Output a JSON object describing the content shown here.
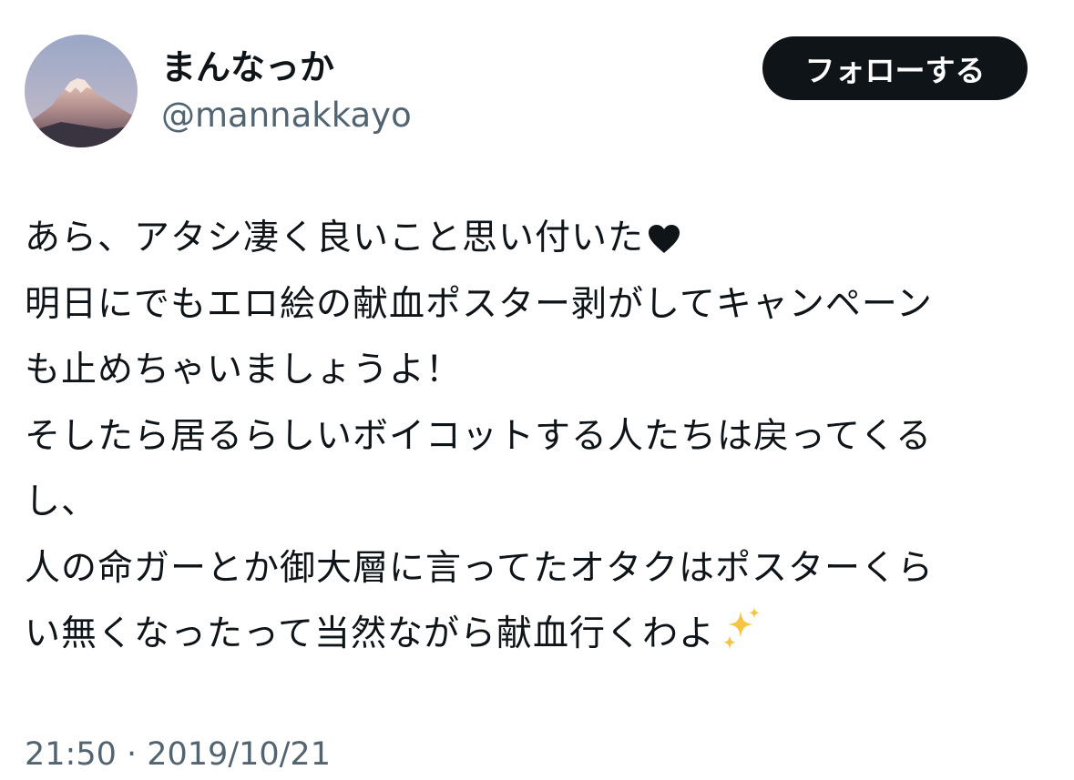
{
  "author": {
    "display_name": "まんなっか",
    "handle": "@mannakkayo",
    "avatar_icon": "mount-fuji-avatar"
  },
  "follow_button": {
    "label": "フォローする"
  },
  "tweet": {
    "lines": [
      "あら、アタシ凄く良いこと思い付いた",
      "明日にでもエロ絵の献血ポスター剥がしてキャンペーン",
      "も止めちゃいましょうよ！",
      "そしたら居るらしいボイコットする人たちは戻ってくる",
      "し、",
      "人の命ガーとか御大層に言ってたオタクはポスターくら",
      "い無くなったって当然ながら献血行くわよ"
    ],
    "emojis": {
      "line1_end": "black-heart-icon",
      "line7_end": "sparkles-icon"
    }
  },
  "meta": {
    "timestamp": "21:50 · 2019/10/21"
  },
  "colors": {
    "text_primary": "#0f1419",
    "text_secondary": "#536471",
    "button_bg": "#0f1419",
    "sparkle": "#f5c542"
  }
}
